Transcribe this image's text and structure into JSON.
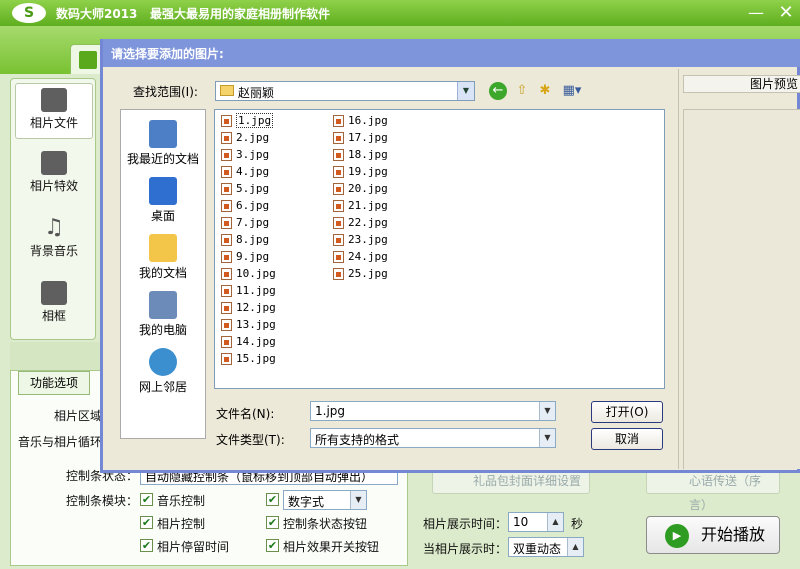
{
  "app": {
    "logo": "S",
    "title": "数码大师2013",
    "slogan": "最强大最易用的家庭相册制作软件",
    "minimize": "—",
    "close": "✕"
  },
  "sidebar": {
    "items": [
      {
        "label": "相片文件",
        "icon": "camera-icon"
      },
      {
        "label": "相片特效",
        "icon": "effects-icon"
      },
      {
        "label": "背景音乐",
        "icon": "music-note-icon"
      },
      {
        "label": "相框",
        "icon": "frame-icon"
      }
    ]
  },
  "func": {
    "tab": "功能选项",
    "area_label": "相片区域",
    "loop_label": "音乐与相片循环",
    "ctrl_state_label": "控制条状态：",
    "ctrl_state_value": "自动隐藏控制条（鼠标移到顶部自动弹出）",
    "ctrl_module_label": "控制条模块：",
    "checks": [
      {
        "label": "音乐控制",
        "checked": true
      },
      {
        "label": "数字式",
        "checked": true
      },
      {
        "label": "相片控制",
        "checked": true
      },
      {
        "label": "控制条状态按钮",
        "checked": true
      },
      {
        "label": "相片停留时间",
        "checked": true
      },
      {
        "label": "相片效果开关按钮",
        "checked": true
      }
    ],
    "check_mark": "✔",
    "digital_combo": "数字式"
  },
  "right": {
    "gift_btn": "礼品包封面详细设置",
    "heart_btn": "心语传送（序言）",
    "duration_label": "相片展示时间：",
    "duration_value": "10",
    "duration_unit": "秒",
    "show_label": "当相片展示时：",
    "show_value": "双重动态",
    "play_label": "开始播放",
    "play_icon": "▶"
  },
  "dialog": {
    "title": "请选择要添加的图片:",
    "lookin_label": "查找范围(I):",
    "lookin_value": "赵丽颖",
    "places": [
      {
        "label": "我最近的文档",
        "icon": "recent-docs-icon",
        "color": "#4d7fc6"
      },
      {
        "label": "桌面",
        "icon": "desktop-icon",
        "color": "#2f6fcf"
      },
      {
        "label": "我的文档",
        "icon": "my-docs-icon",
        "color": "#f3c64a"
      },
      {
        "label": "我的电脑",
        "icon": "my-computer-icon",
        "color": "#6d8bb8"
      },
      {
        "label": "网上邻居",
        "icon": "network-icon",
        "color": "#3c8fcf"
      }
    ],
    "files": [
      "1.jpg",
      "2.jpg",
      "3.jpg",
      "4.jpg",
      "5.jpg",
      "6.jpg",
      "7.jpg",
      "8.jpg",
      "9.jpg",
      "10.jpg",
      "11.jpg",
      "12.jpg",
      "13.jpg",
      "14.jpg",
      "15.jpg",
      "16.jpg",
      "17.jpg",
      "18.jpg",
      "19.jpg",
      "20.jpg",
      "21.jpg",
      "22.jpg",
      "23.jpg",
      "24.jpg",
      "25.jpg"
    ],
    "selected_file": "1.jpg",
    "fname_label": "文件名(N):",
    "fname_value": "1.jpg",
    "ftype_label": "文件类型(T):",
    "ftype_value": "所有支持的格式",
    "open_btn": "打开(O)",
    "cancel_btn": "取消",
    "preview_label": "图片预览",
    "dropdown_arrow": "▼"
  }
}
